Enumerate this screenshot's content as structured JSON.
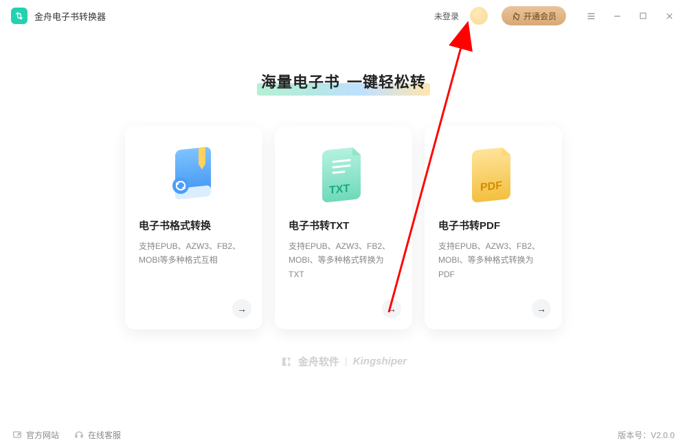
{
  "header": {
    "app_title": "金舟电子书转换器",
    "login_status": "未登录",
    "vip_label": "开通会员"
  },
  "hero": {
    "part1": "海量电子书",
    "part2": "一键轻松转"
  },
  "cards": [
    {
      "title": "电子书格式转换",
      "desc": "支持EPUB、AZW3、FB2、MOBI等多种格式互相",
      "icon": "book-convert-icon",
      "color": "#4ea8ff"
    },
    {
      "title": "电子书转TXT",
      "desc": "支持EPUB、AZW3、FB2、MOBI、等多种格式转换为TXT",
      "icon": "txt-icon",
      "color": "#6fe3c0"
    },
    {
      "title": "电子书转PDF",
      "desc": "支持EPUB、AZW3、FB2、MOBI、等多种格式转换为PDF",
      "icon": "pdf-icon",
      "color": "#f7c94b"
    }
  ],
  "brand": {
    "cn": "金舟软件",
    "en": "Kingshiper"
  },
  "bottom": {
    "website": "官方网站",
    "support": "在线客服",
    "version_label": "版本号：",
    "version": "V2.0.0"
  }
}
